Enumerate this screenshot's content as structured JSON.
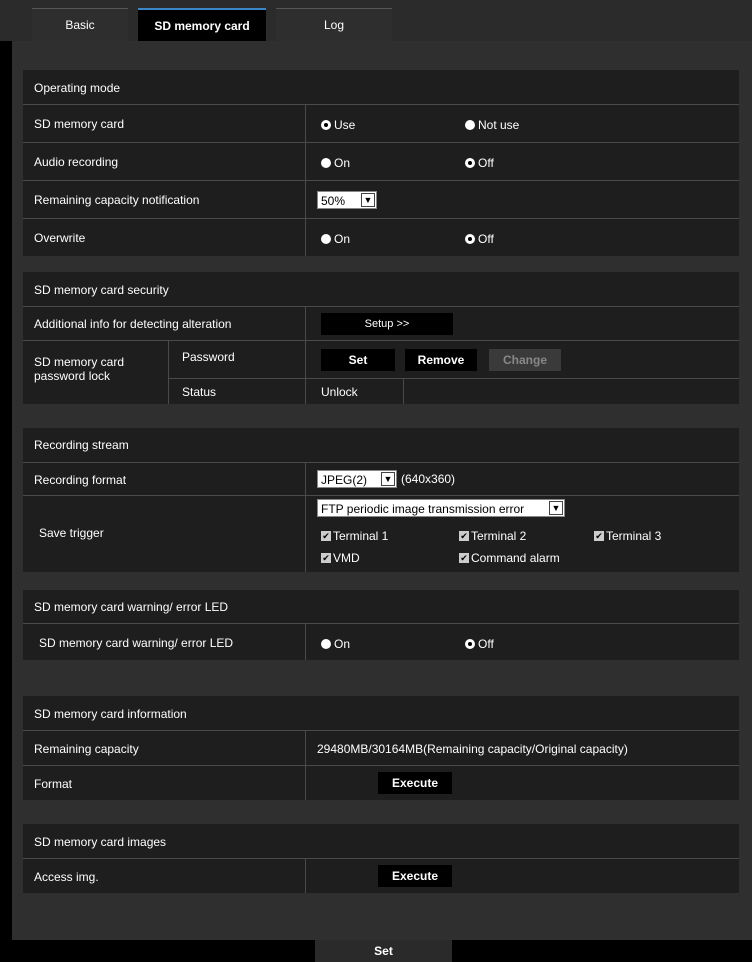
{
  "tabs": [
    "Basic",
    "SD memory card",
    "Log"
  ],
  "operating_mode": {
    "title": "Operating mode",
    "sd_card": {
      "label": "SD memory card",
      "opt1": "Use",
      "opt2": "Not use"
    },
    "audio": {
      "label": "Audio recording",
      "opt1": "On",
      "opt2": "Off"
    },
    "remaining": {
      "label": "Remaining capacity notification",
      "value": "50%"
    },
    "overwrite": {
      "label": "Overwrite",
      "opt1": "On",
      "opt2": "Off"
    }
  },
  "security": {
    "title": "SD memory card security",
    "alteration": {
      "label": "Additional info for detecting alteration",
      "button": "Setup >>"
    },
    "lock_label_1": "SD memory card",
    "lock_label_2": "password lock",
    "password_label": "Password",
    "set": "Set",
    "remove": "Remove",
    "change": "Change",
    "status_label": "Status",
    "status_value": "Unlock"
  },
  "stream": {
    "title": "Recording stream",
    "format_label": "Recording format",
    "format_value": "JPEG(2)",
    "format_res": "(640x360)",
    "trigger_label": "Save trigger",
    "trigger_value": "FTP periodic image transmission error",
    "checks": [
      "Terminal 1",
      "Terminal 2",
      "Terminal 3",
      "VMD",
      "Command alarm"
    ]
  },
  "led": {
    "title": "SD memory card warning/ error LED",
    "label": "SD memory card warning/ error LED",
    "opt1": "On",
    "opt2": "Off"
  },
  "info": {
    "title": "SD memory card information",
    "remaining_label": "Remaining capacity",
    "remaining_value": "29480MB/30164MB(Remaining capacity/Original capacity)",
    "format_label": "Format",
    "execute": "Execute"
  },
  "images": {
    "title": "SD memory card images",
    "access_label": "Access img.",
    "execute": "Execute"
  },
  "footer_set": "Set"
}
